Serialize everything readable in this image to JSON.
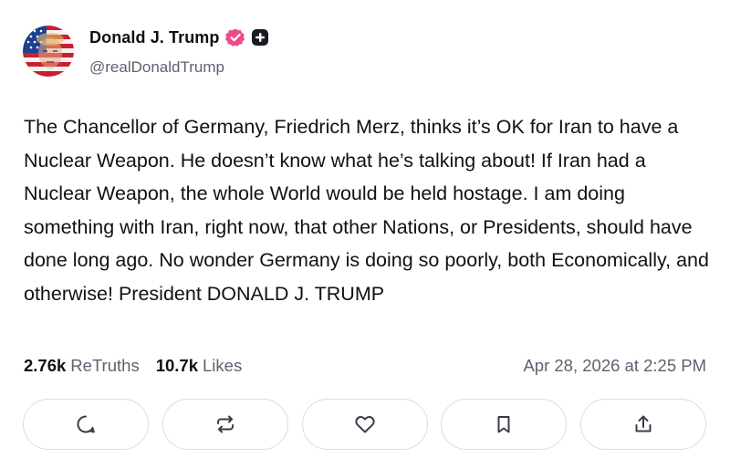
{
  "author": {
    "display_name": "Donald J. Trump",
    "handle": "@realDonaldTrump",
    "verified_icon": "verified-badge-icon",
    "verified_color": "#ee4a8a",
    "plus_icon": "plus-badge-icon"
  },
  "post": {
    "text": "The Chancellor of Germany, Friedrich Merz, thinks it’s OK for Iran to have a Nuclear Weapon. He doesn’t know what he’s talking about! If Iran had a Nuclear Weapon, the whole World would be held hostage. I am doing something with Iran, right now, that other Nations, or Presidents, should have done long ago. No wonder Germany is doing so poorly, both Economically, and otherwise! President DONALD J. TRUMP"
  },
  "stats": {
    "retruths_count": "2.76k",
    "retruths_label": "ReTruths",
    "likes_count": "10.7k",
    "likes_label": "Likes",
    "timestamp": "Apr 28, 2026 at 2:25 PM"
  },
  "actions": [
    {
      "name": "reply",
      "icon": "comment-icon"
    },
    {
      "name": "retruth",
      "icon": "repost-icon"
    },
    {
      "name": "like",
      "icon": "heart-icon"
    },
    {
      "name": "bookmark",
      "icon": "bookmark-icon"
    },
    {
      "name": "share",
      "icon": "share-icon"
    }
  ],
  "colors": {
    "text": "#111116",
    "muted": "#606070",
    "border": "#dcdce2",
    "icon": "#3c3c48"
  }
}
